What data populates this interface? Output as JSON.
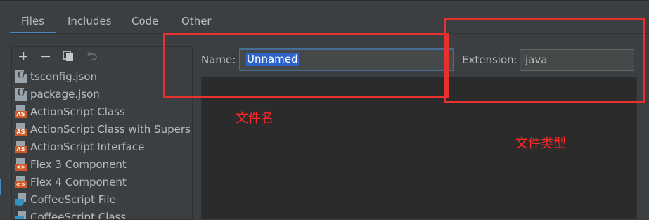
{
  "tabs": [
    "Files",
    "Includes",
    "Code",
    "Other"
  ],
  "toolbar": {
    "icons": [
      "add-icon",
      "remove-icon",
      "copy-icon",
      "undo-icon"
    ]
  },
  "templates": [
    {
      "label": "tsconfig.json",
      "icon": "json-file-icon"
    },
    {
      "label": "package.json",
      "icon": "json-file-icon"
    },
    {
      "label": "ActionScript Class",
      "icon": "actionscript-icon"
    },
    {
      "label": "ActionScript Class with Supers",
      "icon": "actionscript-icon"
    },
    {
      "label": "ActionScript Interface",
      "icon": "actionscript-icon"
    },
    {
      "label": "Flex 3 Component",
      "icon": "flex-component-icon"
    },
    {
      "label": "Flex 4 Component",
      "icon": "flex-component-icon"
    },
    {
      "label": "CoffeeScript File",
      "icon": "coffeescript-icon"
    },
    {
      "label": "CoffeeScript Class",
      "icon": "coffeescript-icon"
    }
  ],
  "form": {
    "name_label": "Name:",
    "name_value": "Unnamed",
    "extension_label": "Extension:",
    "extension_value": "java"
  },
  "annotations": {
    "filename_note": "文件名",
    "filetype_note": "文件类型"
  },
  "colors": {
    "background": "#3c3f41",
    "editor": "#2b2b2b",
    "accent": "#4a88c7",
    "selection": "#2f65ca",
    "annotation": "#e8302e"
  }
}
